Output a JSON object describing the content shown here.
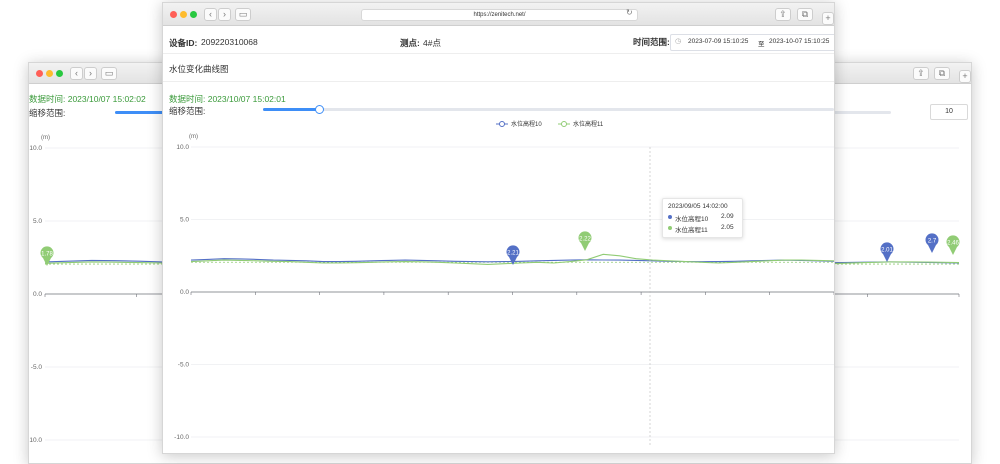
{
  "browser": {
    "url": "https://zenitech.net/"
  },
  "back_window": {
    "data_time": "数据时间: 2023/10/07 15:02:02",
    "zoom_label": "缩移范围:",
    "zoom_value": "10"
  },
  "front_window": {
    "device_label": "设备ID:",
    "device_id": "209220310068",
    "point_label": "测点:",
    "point_value": "4#点",
    "range_label": "时间范围:",
    "range_start": "2023-07-09 15:10:25",
    "range_sep": "至",
    "range_end": "2023-10-07 15:10:25",
    "panel_title": "水位变化曲线图",
    "data_time": "数据时间: 2023/10/07 15:02:01",
    "zoom_label": "缩移范围:"
  },
  "tooltip": {
    "time": "2023/09/05 14:02:00",
    "rows": [
      {
        "name": "水位高程10",
        "value": "2.09",
        "color": "#5470c6"
      },
      {
        "name": "水位高程11",
        "value": "2.05",
        "color": "#91cc75"
      }
    ]
  },
  "markers": {
    "front": [
      {
        "label": "2.21",
        "color": "#5470c6"
      },
      {
        "label": "2.22",
        "color": "#91cc75"
      }
    ],
    "back": [
      {
        "label": "1.78",
        "color": "#91cc75"
      },
      {
        "label": "2.01",
        "color": "#5470c6"
      },
      {
        "label": "2.7",
        "color": "#5470c6"
      },
      {
        "label": "2.46",
        "color": "#91cc75"
      }
    ]
  },
  "chart_data": {
    "type": "line",
    "ylabel": "(m)",
    "ylim": [
      -10,
      10
    ],
    "yticks": [
      "10.0",
      "5.0",
      "0.0",
      "-5.0",
      "-10.0"
    ],
    "grid": true,
    "legend_position": "top-center",
    "series": [
      {
        "name": "水位高程10",
        "color": "#5470c6",
        "values": [
          2.2,
          2.25,
          2.3,
          2.28,
          2.25,
          2.2,
          2.18,
          2.15,
          2.1,
          2.1,
          2.12,
          2.15,
          2.18,
          2.2,
          2.18,
          2.15,
          2.12,
          2.1,
          2.08,
          2.1,
          2.12,
          2.15,
          2.18,
          2.2,
          2.22,
          2.21,
          2.2,
          2.18,
          2.15,
          2.12,
          2.1,
          2.09,
          2.1,
          2.12,
          2.15,
          2.18,
          2.2,
          2.18,
          2.15,
          2.12
        ]
      },
      {
        "name": "水位高程11",
        "color": "#91cc75",
        "values": [
          2.1,
          2.15,
          2.2,
          2.18,
          2.15,
          2.12,
          2.1,
          2.05,
          2.0,
          2.0,
          2.02,
          2.05,
          2.08,
          2.1,
          2.08,
          2.05,
          2.0,
          1.95,
          1.9,
          1.95,
          2.0,
          2.05,
          2.0,
          2.1,
          2.22,
          2.6,
          2.5,
          2.3,
          2.2,
          2.15,
          2.1,
          2.05,
          2.0,
          2.05,
          2.1,
          2.15,
          2.2,
          2.2,
          2.18,
          2.15
        ]
      }
    ]
  }
}
